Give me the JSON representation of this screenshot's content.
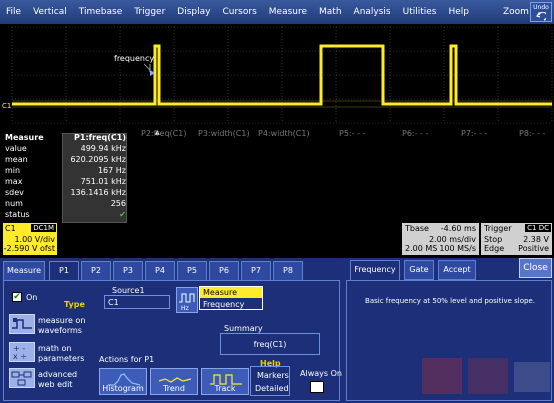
{
  "menubar": {
    "items": [
      "File",
      "Vertical",
      "Timebase",
      "Trigger",
      "Display",
      "Cursors",
      "Measure",
      "Math",
      "Analysis",
      "Utilities",
      "Help"
    ],
    "zoom_label": "Zoom",
    "undo_label": "Undo"
  },
  "grid": {
    "marker_label": "frequency",
    "channel_marker": "C1"
  },
  "param_bar": {
    "p1": "▲",
    "p2": "P2:freq(C1)",
    "p3": "P3:width(C1)",
    "p4": "P4:width(C1)",
    "p5": "P5:- - -",
    "p6": "P6:- - -",
    "p7": "P7:- - -",
    "p8": "P8:- - -"
  },
  "measure_table": {
    "header_label": "Measure",
    "header_value": "P1:freq(C1)",
    "rows": [
      {
        "label": "value",
        "value": "499.94 kHz"
      },
      {
        "label": "mean",
        "value": "620.2095 kHz"
      },
      {
        "label": "min",
        "value": "167 Hz"
      },
      {
        "label": "max",
        "value": "751.01 kHz"
      },
      {
        "label": "sdev",
        "value": "136.1416 kHz"
      },
      {
        "label": "num",
        "value": "256"
      },
      {
        "label": "status",
        "value": "✔"
      }
    ]
  },
  "channel": {
    "name": "C1",
    "coupling": "DC1M",
    "vdiv": "1.00 V/div",
    "offset": "-2.590 V ofst",
    "color": "#ffeb2a"
  },
  "timebase": {
    "label": "Tbase",
    "delay": "-4.60 ms",
    "time_div": "2.00 ms/div",
    "samples": "2.00 MS",
    "rate": "100 MS/s"
  },
  "trigger": {
    "label": "Trigger",
    "source_tag": "C1 DC",
    "mode": "Stop",
    "level": "2.38 V",
    "type": "Edge",
    "slope": "Positive"
  },
  "dialog": {
    "tabs": [
      "Measure",
      "P1",
      "P2",
      "P3",
      "P4",
      "P5",
      "P6",
      "P7",
      "P8"
    ],
    "on_label": "On",
    "type_label": "Type",
    "type_options": [
      {
        "text": "measure on\nwaveforms",
        "icon": "waveform-measure-icon"
      },
      {
        "text": "math on\nparameters",
        "icon": "math-parameters-icon"
      },
      {
        "text": "advanced\nweb edit",
        "icon": "web-edit-icon"
      }
    ],
    "source_label": "Source1",
    "source_value": "C1",
    "measure_selected": "Measure",
    "measure_item": "Frequency",
    "summary_label": "Summary",
    "summary_value": "freq(C1)",
    "actions_label": "Actions for P1",
    "actions": [
      "Histogram",
      "Trend",
      "Track"
    ],
    "help_label": "Help",
    "markers_line1": "Markers",
    "markers_line2": "Detailed",
    "always_on_label": "Always On"
  },
  "right_panel": {
    "tabs": [
      "Frequency",
      "Gate",
      "Accept"
    ],
    "close_label": "Close",
    "description": "Basic frequency at 50% level and positive slope."
  },
  "colors": {
    "menubar": "#1f3a78",
    "dialog_bg": "#1d2f78",
    "trace": "#ffeb2a",
    "grid": "#555555"
  }
}
